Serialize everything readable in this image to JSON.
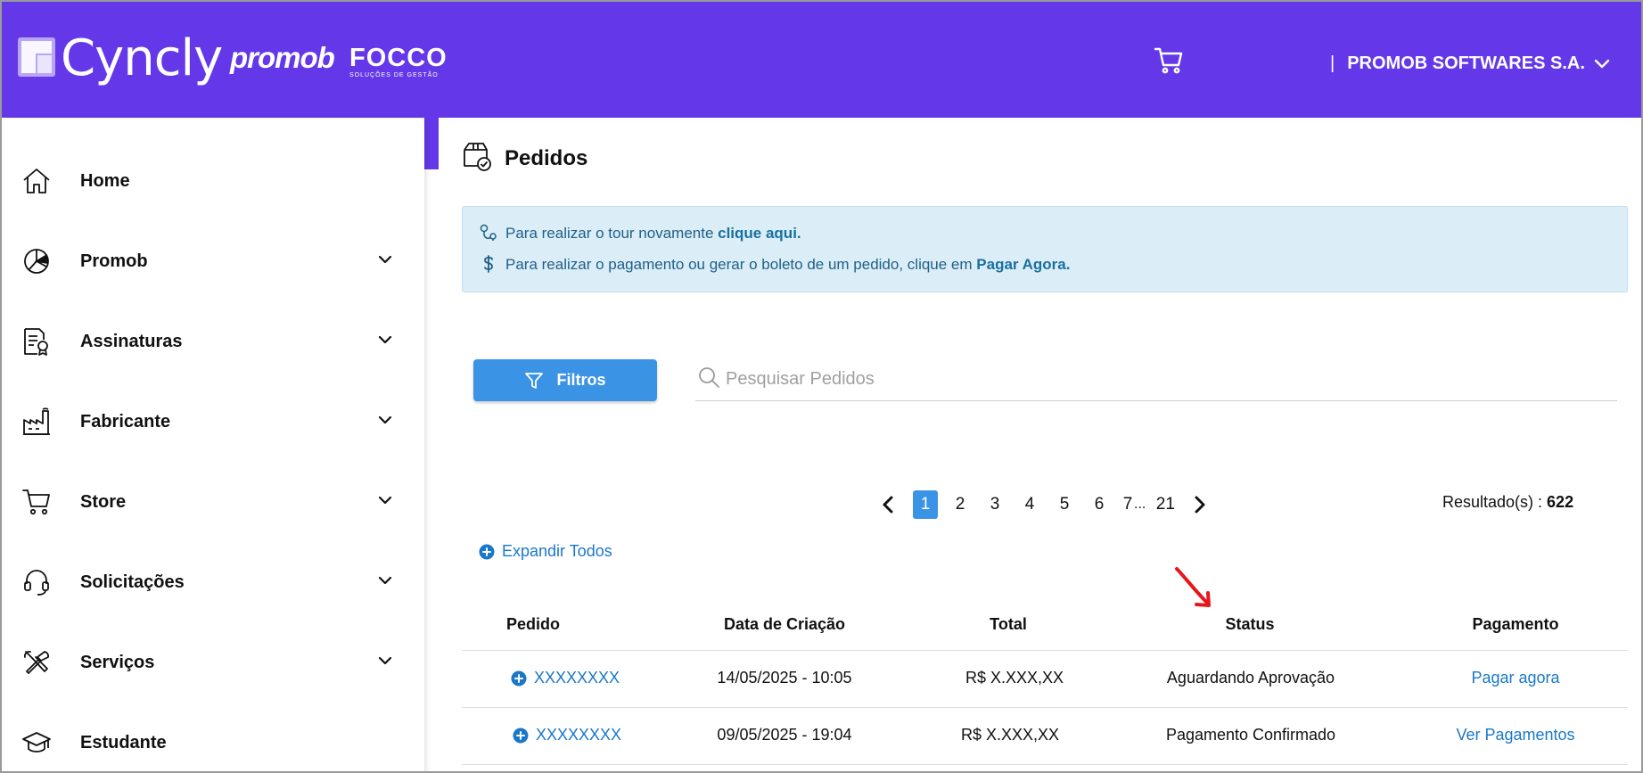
{
  "header": {
    "brand": "Cyncly",
    "brand_promob": "promob",
    "brand_focco": "FOCCO",
    "brand_focco_sub": "SOLUÇÕES DE GESTÃO",
    "company_separator": "|",
    "company_name": "PROMOB SOFTWARES S.A."
  },
  "sidebar": {
    "items": [
      {
        "label": "Home",
        "icon": "home-icon"
      },
      {
        "label": "Promob",
        "icon": "promob-icon"
      },
      {
        "label": "Assinaturas",
        "icon": "subscription-document-icon"
      },
      {
        "label": "Fabricante",
        "icon": "factory-icon"
      },
      {
        "label": "Store",
        "icon": "cart-icon"
      },
      {
        "label": "Solicitações",
        "icon": "headset-icon"
      },
      {
        "label": "Serviços",
        "icon": "tools-icon"
      },
      {
        "label": "Estudante",
        "icon": "graduation-cap-icon"
      }
    ]
  },
  "main": {
    "title": "Pedidos",
    "info": {
      "tour_text": "Para realizar o tour novamente ",
      "tour_link": "clique aqui.",
      "payment_text": "Para realizar o pagamento ou gerar o boleto de um pedido, clique em ",
      "payment_link": "Pagar Agora."
    },
    "filters_label": "Filtros",
    "search_placeholder": "Pesquisar Pedidos",
    "pagination": {
      "pages": [
        "1",
        "2",
        "3",
        "4",
        "5",
        "6",
        "7"
      ],
      "ellipsis": "...",
      "last": "21",
      "active": "1"
    },
    "results_label": "Resultado(s) : ",
    "results_count": "622",
    "expand_all": "Expandir Todos",
    "table": {
      "headers": [
        "Pedido",
        "Data de Criação",
        "Total",
        "Status",
        "Pagamento"
      ],
      "rows": [
        {
          "pedido": "XXXXXXXX",
          "data": "14/05/2025 - 10:05",
          "total": "R$ X.XXX,XX",
          "status": "Aguardando Aprovação",
          "pagamento": "Pagar agora"
        },
        {
          "pedido": "XXXXXXXX",
          "data": "09/05/2025 - 19:04",
          "total": "R$ X.XXX,XX",
          "status": "Pagamento Confirmado",
          "pagamento": "Ver Pagamentos"
        }
      ]
    }
  },
  "colors": {
    "header_bg": "#6438e9",
    "primary_button": "#3b93e6",
    "link": "#1a78c9",
    "info_bg": "#dbeef7",
    "annotation": "#e8161b"
  }
}
